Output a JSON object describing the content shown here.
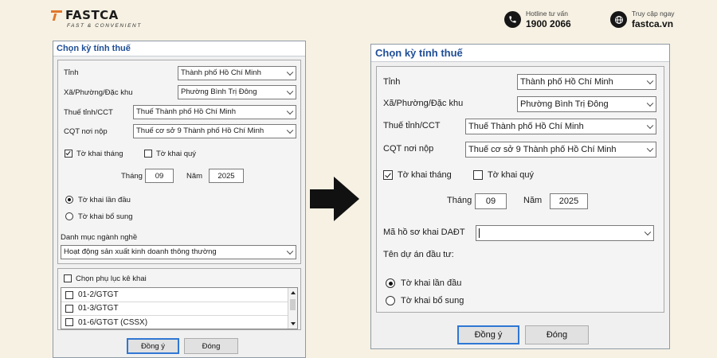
{
  "header": {
    "brand": "FASTCA",
    "tagline": "FAST & CONVENIENT",
    "hotline_label": "Hotline tư vấn",
    "hotline_number": "1900 2066",
    "web_label": "Truy cập ngay",
    "web_url": "fastca.vn"
  },
  "left": {
    "title": "Chọn kỳ tính thuế",
    "tinh_label": "Tỉnh",
    "tinh_value": "Thành phố Hồ Chí Minh",
    "xa_label": "Xã/Phường/Đặc khu",
    "xa_value": "Phường Bình Trị Đông",
    "thue_label": "Thuế tỉnh/CCT",
    "thue_value": "Thuế Thành phố Hồ Chí Minh",
    "cqt_label": "CQT nơi nộp",
    "cqt_value": "Thuế cơ sở 9 Thành phố Hồ Chí Minh",
    "to_khai_thang": "Tờ khai tháng",
    "to_khai_quy": "Tờ khai quý",
    "thang_label": "Tháng",
    "thang_value": "09",
    "nam_label": "Năm",
    "nam_value": "2025",
    "lan_dau": "Tờ khai lần đầu",
    "bo_sung": "Tờ khai bổ sung",
    "danh_muc_label": "Danh mục ngành nghề",
    "danh_muc_value": "Hoạt động sản xuất kinh doanh thông thường",
    "phu_luc_label": "Chọn phụ lục kê khai",
    "phu_luc": [
      "01-2/GTGT",
      "01-3/GTGT",
      "01-6/GTGT (CSSX)"
    ],
    "ok": "Đồng ý",
    "close": "Đóng"
  },
  "right": {
    "title": "Chọn kỳ tính thuế",
    "tinh_label": "Tỉnh",
    "tinh_value": "Thành phố Hồ Chí Minh",
    "xa_label": "Xã/Phường/Đặc khu",
    "xa_value": "Phường Bình Trị Đông",
    "thue_label": "Thuế tỉnh/CCT",
    "thue_value": "Thuế Thành phố Hồ Chí Minh",
    "cqt_label": "CQT nơi nộp",
    "cqt_value": "Thuế cơ sở 9 Thành phố Hồ Chí Minh",
    "to_khai_thang": "Tờ khai tháng",
    "to_khai_quy": "Tờ khai quý",
    "thang_label": "Tháng",
    "thang_value": "09",
    "nam_label": "Năm",
    "nam_value": "2025",
    "ma_ho_so_label": "Mã hồ sơ khai DAĐT",
    "ma_ho_so_value": "",
    "ten_du_an_label": "Tên dự án đầu tư:",
    "lan_dau": "Tờ khai lần đầu",
    "bo_sung": "Tờ khai bổ sung",
    "ok": "Đồng ý",
    "close": "Đóng"
  },
  "colors": {
    "page_bg": "#f6f1e3",
    "title_blue": "#1f4e96",
    "brand_orange": "#e0772b",
    "default_button_border": "#2f77d4"
  },
  "icons": [
    "phone-icon",
    "globe-icon",
    "arrow-right-icon",
    "chevron-down-icon",
    "checkbox-checked-icon"
  ]
}
